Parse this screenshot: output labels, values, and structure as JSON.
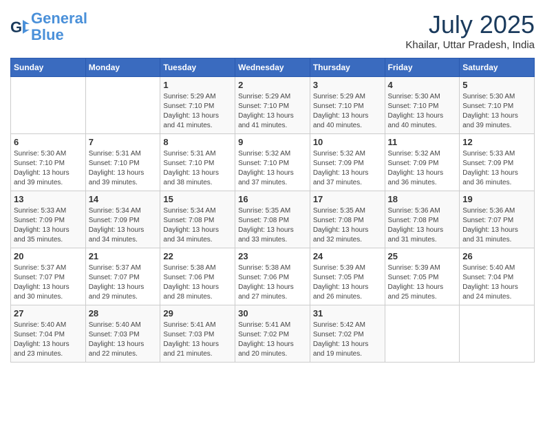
{
  "header": {
    "logo_line1": "General",
    "logo_line2": "Blue",
    "month_title": "July 2025",
    "location": "Khailar, Uttar Pradesh, India"
  },
  "days_of_week": [
    "Sunday",
    "Monday",
    "Tuesday",
    "Wednesday",
    "Thursday",
    "Friday",
    "Saturday"
  ],
  "weeks": [
    [
      {
        "day": null,
        "info": null
      },
      {
        "day": null,
        "info": null
      },
      {
        "day": "1",
        "info": "Sunrise: 5:29 AM\nSunset: 7:10 PM\nDaylight: 13 hours and 41 minutes."
      },
      {
        "day": "2",
        "info": "Sunrise: 5:29 AM\nSunset: 7:10 PM\nDaylight: 13 hours and 41 minutes."
      },
      {
        "day": "3",
        "info": "Sunrise: 5:29 AM\nSunset: 7:10 PM\nDaylight: 13 hours and 40 minutes."
      },
      {
        "day": "4",
        "info": "Sunrise: 5:30 AM\nSunset: 7:10 PM\nDaylight: 13 hours and 40 minutes."
      },
      {
        "day": "5",
        "info": "Sunrise: 5:30 AM\nSunset: 7:10 PM\nDaylight: 13 hours and 39 minutes."
      }
    ],
    [
      {
        "day": "6",
        "info": "Sunrise: 5:30 AM\nSunset: 7:10 PM\nDaylight: 13 hours and 39 minutes."
      },
      {
        "day": "7",
        "info": "Sunrise: 5:31 AM\nSunset: 7:10 PM\nDaylight: 13 hours and 39 minutes."
      },
      {
        "day": "8",
        "info": "Sunrise: 5:31 AM\nSunset: 7:10 PM\nDaylight: 13 hours and 38 minutes."
      },
      {
        "day": "9",
        "info": "Sunrise: 5:32 AM\nSunset: 7:10 PM\nDaylight: 13 hours and 37 minutes."
      },
      {
        "day": "10",
        "info": "Sunrise: 5:32 AM\nSunset: 7:09 PM\nDaylight: 13 hours and 37 minutes."
      },
      {
        "day": "11",
        "info": "Sunrise: 5:32 AM\nSunset: 7:09 PM\nDaylight: 13 hours and 36 minutes."
      },
      {
        "day": "12",
        "info": "Sunrise: 5:33 AM\nSunset: 7:09 PM\nDaylight: 13 hours and 36 minutes."
      }
    ],
    [
      {
        "day": "13",
        "info": "Sunrise: 5:33 AM\nSunset: 7:09 PM\nDaylight: 13 hours and 35 minutes."
      },
      {
        "day": "14",
        "info": "Sunrise: 5:34 AM\nSunset: 7:09 PM\nDaylight: 13 hours and 34 minutes."
      },
      {
        "day": "15",
        "info": "Sunrise: 5:34 AM\nSunset: 7:08 PM\nDaylight: 13 hours and 34 minutes."
      },
      {
        "day": "16",
        "info": "Sunrise: 5:35 AM\nSunset: 7:08 PM\nDaylight: 13 hours and 33 minutes."
      },
      {
        "day": "17",
        "info": "Sunrise: 5:35 AM\nSunset: 7:08 PM\nDaylight: 13 hours and 32 minutes."
      },
      {
        "day": "18",
        "info": "Sunrise: 5:36 AM\nSunset: 7:08 PM\nDaylight: 13 hours and 31 minutes."
      },
      {
        "day": "19",
        "info": "Sunrise: 5:36 AM\nSunset: 7:07 PM\nDaylight: 13 hours and 31 minutes."
      }
    ],
    [
      {
        "day": "20",
        "info": "Sunrise: 5:37 AM\nSunset: 7:07 PM\nDaylight: 13 hours and 30 minutes."
      },
      {
        "day": "21",
        "info": "Sunrise: 5:37 AM\nSunset: 7:07 PM\nDaylight: 13 hours and 29 minutes."
      },
      {
        "day": "22",
        "info": "Sunrise: 5:38 AM\nSunset: 7:06 PM\nDaylight: 13 hours and 28 minutes."
      },
      {
        "day": "23",
        "info": "Sunrise: 5:38 AM\nSunset: 7:06 PM\nDaylight: 13 hours and 27 minutes."
      },
      {
        "day": "24",
        "info": "Sunrise: 5:39 AM\nSunset: 7:05 PM\nDaylight: 13 hours and 26 minutes."
      },
      {
        "day": "25",
        "info": "Sunrise: 5:39 AM\nSunset: 7:05 PM\nDaylight: 13 hours and 25 minutes."
      },
      {
        "day": "26",
        "info": "Sunrise: 5:40 AM\nSunset: 7:04 PM\nDaylight: 13 hours and 24 minutes."
      }
    ],
    [
      {
        "day": "27",
        "info": "Sunrise: 5:40 AM\nSunset: 7:04 PM\nDaylight: 13 hours and 23 minutes."
      },
      {
        "day": "28",
        "info": "Sunrise: 5:40 AM\nSunset: 7:03 PM\nDaylight: 13 hours and 22 minutes."
      },
      {
        "day": "29",
        "info": "Sunrise: 5:41 AM\nSunset: 7:03 PM\nDaylight: 13 hours and 21 minutes."
      },
      {
        "day": "30",
        "info": "Sunrise: 5:41 AM\nSunset: 7:02 PM\nDaylight: 13 hours and 20 minutes."
      },
      {
        "day": "31",
        "info": "Sunrise: 5:42 AM\nSunset: 7:02 PM\nDaylight: 13 hours and 19 minutes."
      },
      {
        "day": null,
        "info": null
      },
      {
        "day": null,
        "info": null
      }
    ]
  ]
}
